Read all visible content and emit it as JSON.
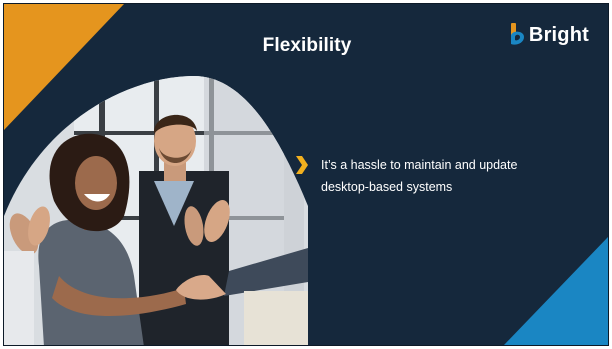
{
  "slide": {
    "title": "Flexibility",
    "logo_icon": "bright-b-icon",
    "logo_text": "Bright",
    "photo_description_icon": "business-team-photo",
    "bullets": [
      {
        "icon": "chevron-right-icon",
        "text": "It’s a hassle to maintain and update desktop-based systems"
      }
    ]
  },
  "colors": {
    "background": "#15283c",
    "accent_orange": "#e5951e",
    "accent_blue": "#1a86c3",
    "bullet_gold": "#f2b01e",
    "text": "#ffffff"
  }
}
